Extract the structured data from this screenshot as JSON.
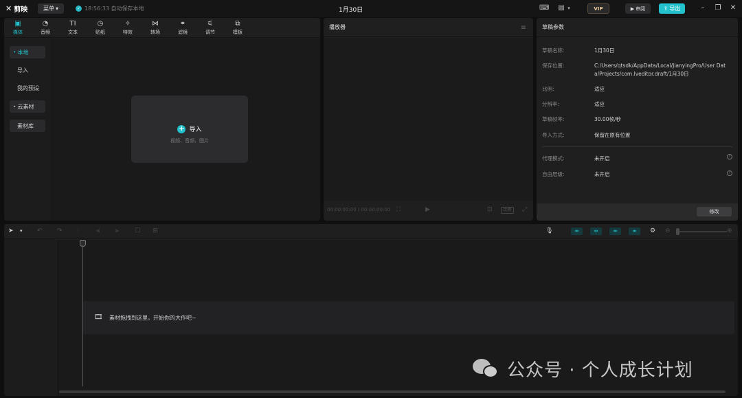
{
  "app": {
    "logo_text": "剪映",
    "menu_label": "菜单",
    "autosave_text": "18:56:33 自动保存本地",
    "doc_title": "1月30日",
    "vip_label": "VIP",
    "review_label": "审阅",
    "export_label": "导出"
  },
  "media_panel": {
    "tabs": [
      {
        "label": "媒体",
        "icon": "media-icon"
      },
      {
        "label": "音频",
        "icon": "audio-icon"
      },
      {
        "label": "文本",
        "icon": "text-icon"
      },
      {
        "label": "贴纸",
        "icon": "sticker-icon"
      },
      {
        "label": "特效",
        "icon": "effects-icon"
      },
      {
        "label": "转场",
        "icon": "transition-icon"
      },
      {
        "label": "滤镜",
        "icon": "filter-icon"
      },
      {
        "label": "调节",
        "icon": "adjust-icon"
      },
      {
        "label": "模板",
        "icon": "template-icon"
      }
    ],
    "sidebar": [
      {
        "label": "本地"
      },
      {
        "label": "导入"
      },
      {
        "label": "我的预设"
      },
      {
        "label": "云素材"
      },
      {
        "label": "素材库"
      }
    ],
    "import_label": "导入",
    "import_hint": "视频、音频、图片"
  },
  "player": {
    "title": "播放器",
    "timecode": "00:00:00:00 / 00:00:00:00",
    "ratio_label": "比例"
  },
  "draft_params": {
    "title": "草稿参数",
    "rows": [
      {
        "label": "草稿名称:",
        "value": "1月30日"
      },
      {
        "label": "保存位置:",
        "value": "C:/Users/qtsdk/AppData/Local/JianyingPro/User Data/Projects/com.lveditor.draft/1月30日"
      },
      {
        "label": "比例:",
        "value": "适应"
      },
      {
        "label": "分辨率:",
        "value": "适应"
      },
      {
        "label": "草稿帧率:",
        "value": "30.00帧/秒"
      },
      {
        "label": "导入方式:",
        "value": "保留在原有位置"
      },
      {
        "label": "代理模式:",
        "value": "未开启"
      },
      {
        "label": "自由层级:",
        "value": "未开启"
      }
    ],
    "edit_label": "修改"
  },
  "timeline": {
    "drop_hint": "素材拖拽到这里，开始你的大作吧~"
  },
  "watermark": {
    "text": "公众号 · 个人成长计划"
  },
  "colors": {
    "accent": "#22c1cc",
    "panel": "#1f1f20",
    "background": "#0f0f10"
  }
}
